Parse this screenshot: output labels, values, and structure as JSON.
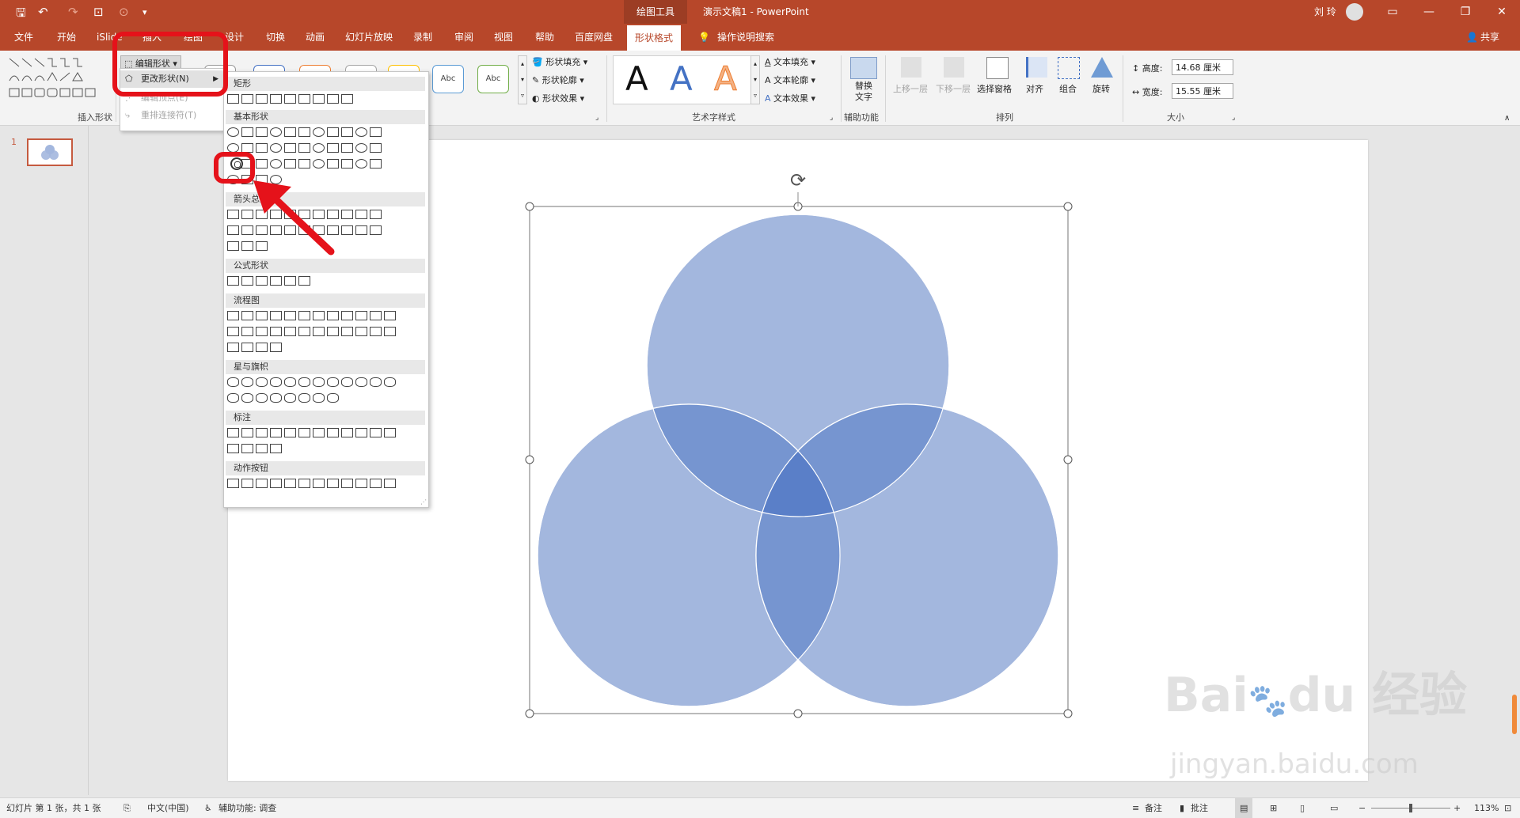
{
  "window": {
    "context_tab": "绘图工具",
    "doc_title": "演示文稿1  -  PowerPoint",
    "user": "刘 玲"
  },
  "tabs": [
    "文件",
    "开始",
    "iSlide",
    "插入",
    "绘图",
    "设计",
    "切换",
    "动画",
    "幻灯片放映",
    "录制",
    "审阅",
    "视图",
    "帮助",
    "百度网盘",
    "形状格式"
  ],
  "active_tab": "形状格式",
  "search_label": "操作说明搜索",
  "share_label": "共享",
  "ribbon": {
    "insert_shapes": {
      "label": "插入形状",
      "edit_shape": "编辑形状",
      "change_shape": "更改形状(N)",
      "edit_points": "编辑顶点(E)",
      "reroute": "重排连接符(T)"
    },
    "shape_styles": {
      "style_samples": [
        "Abc",
        "Abc"
      ],
      "fill": "形状填充",
      "outline": "形状轮廓",
      "effects": "形状效果"
    },
    "wordart": {
      "label": "艺术字样式",
      "sample": [
        "A",
        "A",
        "A"
      ],
      "text_fill": "文本填充",
      "text_outline": "文本轮廓",
      "text_effects": "文本效果"
    },
    "accessibility": {
      "label": "辅助功能",
      "alt_text": "替换文字"
    },
    "arrange": {
      "label": "排列",
      "bring_forward": "上移一层",
      "send_backward": "下移一层",
      "selection_pane": "选择窗格",
      "align": "对齐",
      "group": "组合",
      "rotate": "旋转"
    },
    "size": {
      "label": "大小",
      "height_label": "高度:",
      "height_value": "14.68 厘米",
      "width_label": "宽度:",
      "width_value": "15.55 厘米"
    }
  },
  "gallery": {
    "categories": [
      "矩形",
      "基本形状",
      "箭头总汇",
      "公式形状",
      "流程图",
      "星与旗帜",
      "标注",
      "动作按钮"
    ]
  },
  "thumb_number": "1",
  "statusbar": {
    "slide_info": "幻灯片 第 1 张，共 1 张",
    "language": "中文(中国)",
    "accessibility": "辅助功能: 调查",
    "notes": "备注",
    "comments": "批注",
    "zoom": "113%"
  },
  "venn": {
    "fill": "#a3b7de",
    "overlap2": "#7695d0",
    "overlap3": "#5a7fc8"
  }
}
